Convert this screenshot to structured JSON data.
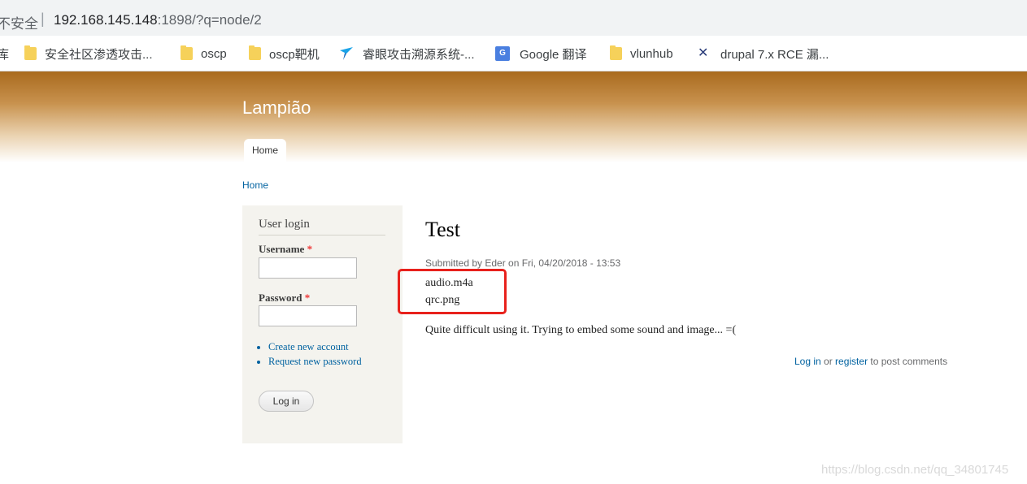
{
  "browser": {
    "security_label": "不安全",
    "separator": "|",
    "url_host": "192.168.145.148",
    "url_path": ":1898/?q=node/2"
  },
  "bookmarks": {
    "items": [
      {
        "icon": "folder-icon",
        "label": "安全社区渗透攻击..."
      },
      {
        "icon": "folder-icon",
        "label": "oscp"
      },
      {
        "icon": "folder-icon",
        "label": "oscp靶机"
      },
      {
        "icon": "arrow-icon",
        "label": "睿眼攻击溯源系统-..."
      },
      {
        "icon": "google-translate-icon",
        "label": "Google 翻译"
      },
      {
        "icon": "folder-icon",
        "label": "vlunhub"
      },
      {
        "icon": "x-icon",
        "label": "drupal 7.x RCE 漏..."
      }
    ],
    "clipped_left_text": "库"
  },
  "site": {
    "name": "Lampião",
    "nav_home": "Home"
  },
  "breadcrumb": "Home",
  "sidebar": {
    "title": "User login",
    "username_label": "Username",
    "password_label": "Password",
    "required_mark": "*",
    "links": [
      "Create new account",
      "Request new password"
    ],
    "login_button": "Log in"
  },
  "node": {
    "title": "Test",
    "submitted": "Submitted by Eder on Fri, 04/20/2018 - 13:53",
    "attachments": [
      "audio.m4a",
      "qrc.png"
    ],
    "body": "Quite difficult using it. Trying to embed some sound and image... =(",
    "comment_login": "Log in",
    "comment_or": " or ",
    "comment_register": "register",
    "comment_suffix": " to post comments"
  },
  "watermark": "https://blog.csdn.net/qq_34801745",
  "colors": {
    "link": "#0062a0",
    "header_brown": "#a96a1e",
    "highlight_red": "#e8211c",
    "sidebar_bg": "#f4f3ee"
  }
}
